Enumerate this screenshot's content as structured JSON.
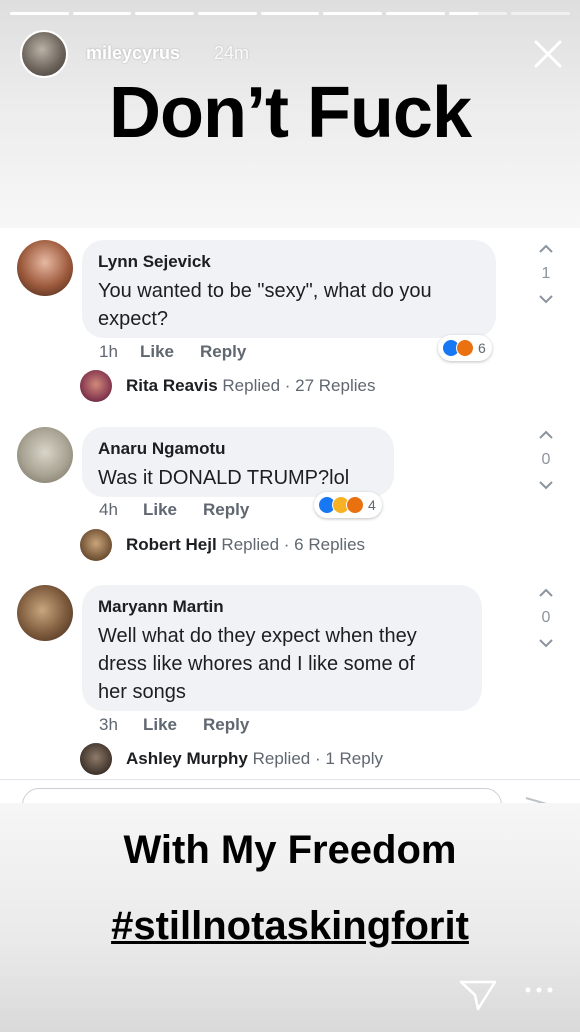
{
  "story": {
    "username": "mileycyrus",
    "time_ago": "24m",
    "headline": "Don’t Fuck",
    "caption_line1": "With My Freedom",
    "caption_line2": "#stillnotaskingforit",
    "progress": [
      1,
      1,
      1,
      1,
      1,
      1,
      1,
      0.5,
      0
    ],
    "colors": {
      "bubble": "#f0f2f5",
      "like": "#1877f2",
      "angry": "#e9710f",
      "haha": "#f7b125"
    }
  },
  "comments": [
    {
      "author": "Lynn Sejevick",
      "text_lines": [
        "You wanted to be \"sexy\", what do you",
        "expect?"
      ],
      "time": "1h",
      "like_label": "Like",
      "reply_label": "Reply",
      "reaction_icons": [
        "like-icon",
        "angry-icon"
      ],
      "reaction_count": "6",
      "vote_count": "1",
      "replied_name": "Rita Reavis",
      "replied_text": " Replied · 27 Replies"
    },
    {
      "author": "Anaru Ngamotu",
      "text_lines": [
        "Was it DONALD TRUMP?lol"
      ],
      "time": "4h",
      "like_label": "Like",
      "reply_label": "Reply",
      "reaction_icons": [
        "like-icon",
        "haha-icon",
        "angry-icon"
      ],
      "reaction_count": "4",
      "vote_count": "0",
      "replied_name": "Robert Hejl",
      "replied_text": " Replied · 6 Replies"
    },
    {
      "author": "Maryann Martin",
      "text_lines": [
        "Well what do they expect when they",
        "dress like whores and I like some of",
        "her songs"
      ],
      "time": "3h",
      "like_label": "Like",
      "reply_label": "Reply",
      "reaction_icons": [],
      "reaction_count": "",
      "vote_count": "0",
      "replied_name": "Ashley Murphy",
      "replied_text": " Replied · 1 Reply"
    }
  ]
}
